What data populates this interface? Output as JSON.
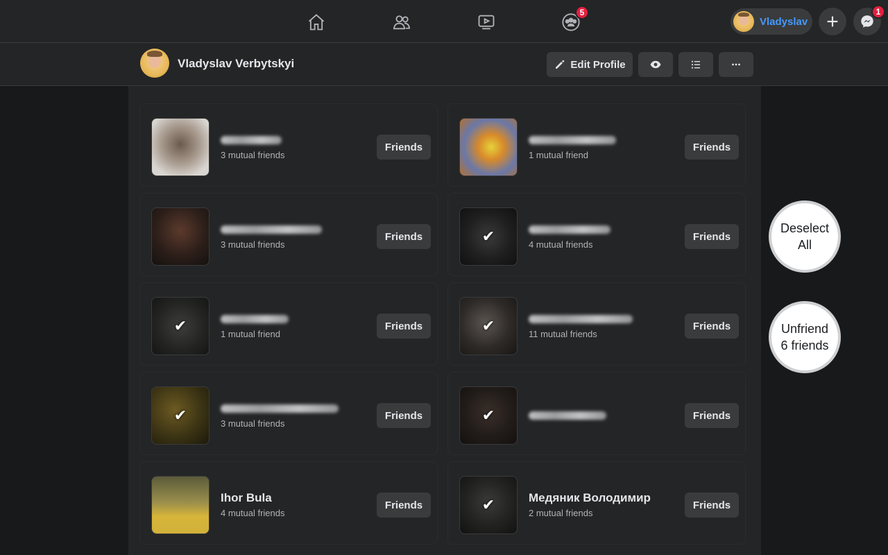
{
  "topnav": {
    "groups_badge": "5",
    "messenger_badge": "1",
    "user_name": "Vladyslav"
  },
  "profile": {
    "name": "Vladyslav Verbytskyi",
    "edit_label": "Edit Profile"
  },
  "friend_cards": [
    {
      "name": "",
      "mutual": "3 mutual friends",
      "button": "Friends",
      "selected": false
    },
    {
      "name": "",
      "mutual": "1 mutual friend",
      "button": "Friends",
      "selected": false
    },
    {
      "name": "",
      "mutual": "3 mutual friends",
      "button": "Friends",
      "selected": false
    },
    {
      "name": "",
      "mutual": "4 mutual friends",
      "button": "Friends",
      "selected": true
    },
    {
      "name": "",
      "mutual": "1 mutual friend",
      "button": "Friends",
      "selected": true
    },
    {
      "name": "",
      "mutual": "11 mutual friends",
      "button": "Friends",
      "selected": true
    },
    {
      "name": "",
      "mutual": "3 mutual friends",
      "button": "Friends",
      "selected": true
    },
    {
      "name": "",
      "mutual": "",
      "button": "Friends",
      "selected": true
    },
    {
      "name": "Ihor Bula",
      "mutual": "4 mutual friends",
      "button": "Friends",
      "selected": false
    },
    {
      "name": "Медяник Володимир",
      "mutual": "2 mutual friends",
      "button": "Friends",
      "selected": true
    }
  ],
  "actions": {
    "deselect_line1": "Deselect",
    "deselect_line2": "All",
    "unfriend_line1": "Unfriend",
    "unfriend_line2": "6 friends"
  },
  "colors": {
    "background": "#18191a",
    "surface": "#242526",
    "button": "#3a3b3c",
    "accent": "#4599ff",
    "badge": "#e41e3f"
  }
}
